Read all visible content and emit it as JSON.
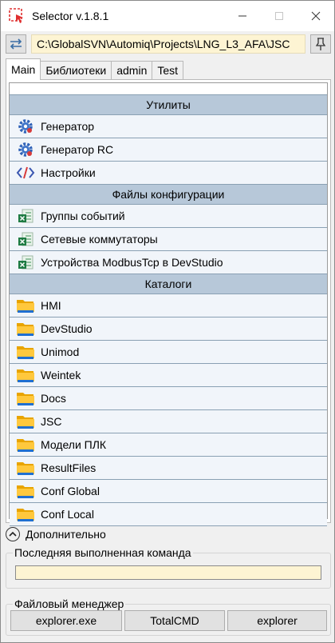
{
  "window": {
    "title": "Selector v.1.8.1",
    "icons": {
      "app": "selector-app-icon",
      "minimize": "minimize-icon",
      "maximize": "maximize-icon",
      "close": "close-icon"
    }
  },
  "path_row": {
    "path": "C:\\GlobalSVN\\Automiq\\Projects\\LNG_L3_AFA\\JSC",
    "swap_icon": "swap-arrows-icon",
    "pin_icon": "pin-icon",
    "path_bg": "#fdf4d3"
  },
  "tabs": [
    {
      "label": "Main",
      "active": true
    },
    {
      "label": "Библиотеки",
      "active": false
    },
    {
      "label": "admin",
      "active": false
    },
    {
      "label": "Test",
      "active": false
    }
  ],
  "sections": [
    {
      "title": "Утилиты",
      "items": [
        {
          "label": "Генератор",
          "icon": "gear-icon"
        },
        {
          "label": "Генератор RC",
          "icon": "gear-icon"
        },
        {
          "label": "Настройки",
          "icon": "code-icon"
        }
      ]
    },
    {
      "title": "Файлы конфигурации",
      "items": [
        {
          "label": "Группы событий",
          "icon": "excel-icon"
        },
        {
          "label": "Сетевые коммутаторы",
          "icon": "excel-icon"
        },
        {
          "label": "Устройства ModbusTcp в DevStudio",
          "icon": "excel-icon"
        }
      ]
    },
    {
      "title": "Каталоги",
      "items": [
        {
          "label": "HMI",
          "icon": "folder-icon"
        },
        {
          "label": "DevStudio",
          "icon": "folder-icon"
        },
        {
          "label": "Unimod",
          "icon": "folder-icon"
        },
        {
          "label": "Weintek",
          "icon": "folder-icon"
        },
        {
          "label": "Docs",
          "icon": "folder-icon"
        },
        {
          "label": "JSC",
          "icon": "folder-icon"
        },
        {
          "label": "Модели ПЛК",
          "icon": "folder-icon"
        },
        {
          "label": "ResultFiles",
          "icon": "folder-icon"
        },
        {
          "label": "Conf Global",
          "icon": "folder-icon"
        },
        {
          "label": "Conf Local",
          "icon": "folder-icon"
        }
      ]
    }
  ],
  "advanced": {
    "label": "Дополнительно",
    "icon": "chevron-up-icon"
  },
  "last_command": {
    "title": "Последняя выполненная команда",
    "value": ""
  },
  "file_manager": {
    "title": "Файловый менеджер",
    "buttons": [
      "explorer.exe",
      "TotalCMD",
      "explorer"
    ]
  },
  "colors": {
    "section_header": "#b7c8d9",
    "item_bg": "#f1f5fa",
    "row_border": "#8aa0b3",
    "field_bg": "#fdf4d3"
  }
}
